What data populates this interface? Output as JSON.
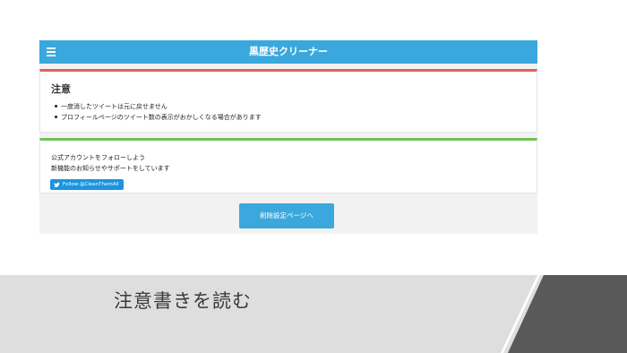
{
  "app": {
    "title": "黒歴史クリーナー",
    "menu_icon": "hamburger-menu-icon"
  },
  "warning_card": {
    "heading": "注意",
    "items": [
      "一度消したツイートは元に戻せません",
      "プロフィールページのツイート数の表示がおかしくなる場合があります"
    ],
    "accent_color": "#e1615a"
  },
  "follow_card": {
    "line1": "公式アカウントをフォローしよう",
    "line2": "新機能のお知らせやサポートをしています",
    "follow_button": "Follow @CleanThemAll",
    "follow_icon": "twitter-bird-icon",
    "accent_color": "#6cc257"
  },
  "action": {
    "button_label": "削除設定ページへ"
  },
  "caption": {
    "text": "注意書きを読む"
  },
  "colors": {
    "brand": "#3aa8dc",
    "twitter": "#1b95e0",
    "band": "#dedede",
    "corner": "#595959"
  }
}
